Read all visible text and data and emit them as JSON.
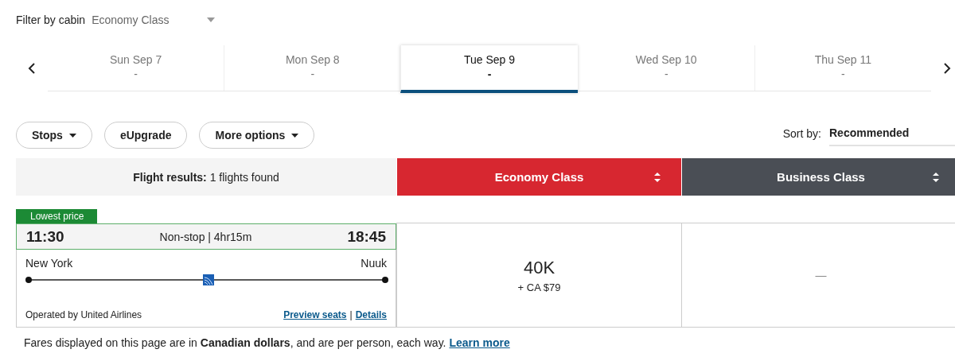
{
  "filter": {
    "label": "Filter by cabin",
    "value": "Economy Class"
  },
  "dates": [
    {
      "day": "Sun Sep 7",
      "price": "-",
      "selected": false
    },
    {
      "day": "Mon Sep 8",
      "price": "-",
      "selected": false
    },
    {
      "day": "Tue Sep 9",
      "price": "-",
      "selected": true
    },
    {
      "day": "Wed Sep 10",
      "price": "-",
      "selected": false
    },
    {
      "day": "Thu Sep 11",
      "price": "-",
      "selected": false
    }
  ],
  "filters": [
    {
      "label": "Stops",
      "dropdown": true
    },
    {
      "label": "eUpgrade",
      "dropdown": false
    },
    {
      "label": "More options",
      "dropdown": true
    }
  ],
  "sort": {
    "label": "Sort by:",
    "value": "Recommended"
  },
  "results_summary": "**Flight results:** 1 flights found",
  "cabins": [
    {
      "label": "Economy Class",
      "color": "#d72730"
    },
    {
      "label": "Business Class",
      "color": "#4a4e55"
    }
  ],
  "flights": [
    {
      "badge": "Lowest price",
      "depart": "11:30",
      "arrive": "18:45",
      "info": "Non-stop | 4hr15m",
      "origin": "New York",
      "destination": "Nuuk",
      "operator": "Operated by United Airlines",
      "links": [
        "Preview seats",
        "Details"
      ],
      "link_separator": "|",
      "fares": [
        {
          "kind": "price",
          "miles": "40K",
          "cash": "+ CA $79"
        },
        {
          "kind": "none",
          "text": "—"
        }
      ]
    }
  ],
  "footer": {
    "text": "Fares displayed on this page are in **Canadian dollars**, and are per person, each way.",
    "link": "Learn more"
  }
}
